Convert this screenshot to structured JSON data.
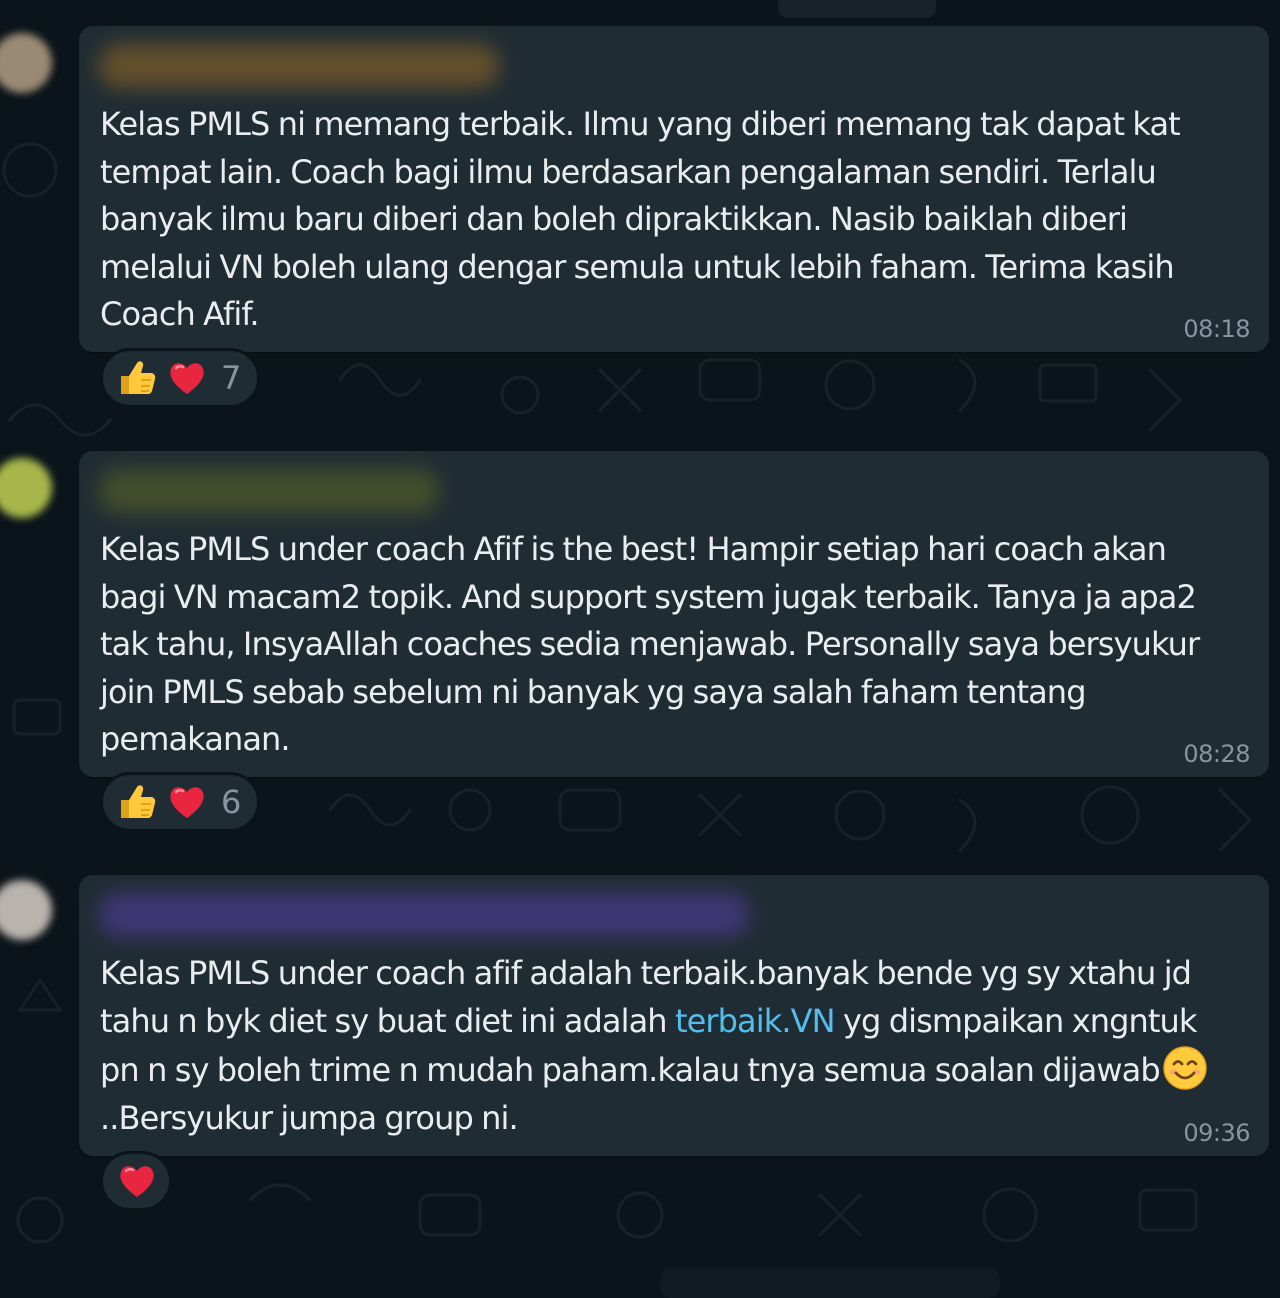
{
  "colors": {
    "chat_background": "#0b141a",
    "bubble_background": "#202c33",
    "message_text": "#e9edef",
    "timestamp_text": "#8696a0",
    "link": "#53bdeb"
  },
  "messages": [
    {
      "sender_name": "",
      "avatar_color": "#9a8a74",
      "sender_name_color": "#7a5c2a",
      "text_lines": [
        "Kelas PMLS ni memang terbaik. Ilmu yang diberi memang tak dapat kat",
        "tempat lain. Coach bagi ilmu berdasarkan pengalaman sendiri. Terlalu",
        "banyak ilmu baru diberi dan boleh dipraktikkan. Nasib baiklah diberi",
        "melalui VN boleh ulang dengar semula untuk lebih faham. Terima kasih",
        "Coach Afif."
      ],
      "time": "08:18",
      "reactions": {
        "emojis": [
          "thumbs-up-icon",
          "red-heart-icon"
        ],
        "count": "7"
      }
    },
    {
      "sender_name": "",
      "avatar_color": "#a7b64a",
      "sender_name_color": "#4f5a2a",
      "text_lines": [
        "Kelas PMLS under coach Afif is the best! Hampir setiap hari coach akan",
        "bagi VN macam2 topik. And support system jugak terbaik. Tanya ja apa2",
        "tak tahu, InsyaAllah coaches sedia menjawab. Personally saya bersyukur",
        "join PMLS sebab sebelum ni banyak yg saya salah faham tentang",
        "pemakanan."
      ],
      "time": "08:28",
      "reactions": {
        "emojis": [
          "thumbs-up-icon",
          "red-heart-icon"
        ],
        "count": "6"
      }
    },
    {
      "sender_name": "",
      "avatar_color": "#b9b3ad",
      "sender_name_color": "#4a3b8c",
      "text_lines": [
        "Kelas PMLS under coach afif adalah terbaik.banyak bende yg sy xtahu jd",
        "tahu n byk diet sy buat diet ini adalah ",
        "pn n sy boleh trime n mudah paham.kalau tnya semua soalan dijawab",
        "..Bersyukur jumpa group ni."
      ],
      "link_text": "terbaik.VN",
      "line2_after_link": " yg dismpaikan xngntuk",
      "inline_emoji": "smiling-face-icon",
      "time": "09:36",
      "reactions": {
        "emojis": [
          "red-heart-icon"
        ],
        "count": ""
      }
    }
  ]
}
